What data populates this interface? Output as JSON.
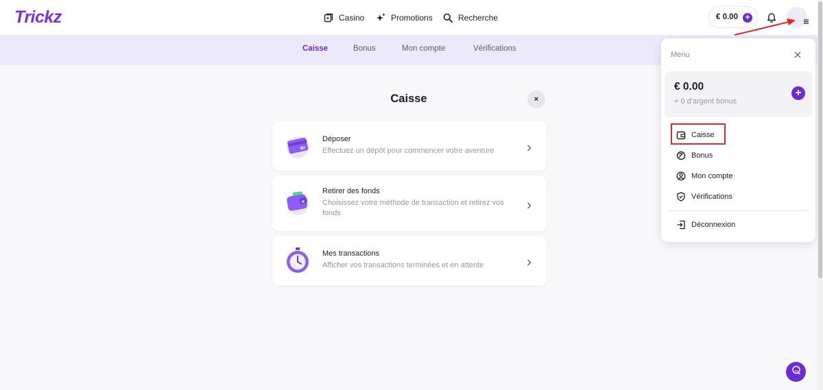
{
  "brand": {
    "logo": "Trickz",
    "accent_color": "#6c2bd9"
  },
  "header": {
    "nav": [
      {
        "label": "Casino",
        "icon": "casino-icon"
      },
      {
        "label": "Promotions",
        "icon": "sparkle-icon"
      },
      {
        "label": "Recherche",
        "icon": "search-icon"
      }
    ],
    "balance": "€ 0.00",
    "add_funds_glyph": "+",
    "notifications_icon": "bell-icon",
    "menu_icon": "hamburger-icon"
  },
  "subnav": {
    "tabs": [
      {
        "label": "Caisse",
        "active": true
      },
      {
        "label": "Bonus",
        "active": false
      },
      {
        "label": "Mon compte",
        "active": false
      },
      {
        "label": "Vérifications",
        "active": false
      }
    ]
  },
  "main": {
    "title": "Caisse",
    "close_glyph": "×",
    "cards": [
      {
        "title": "Déposer",
        "description": "Effectuez un dépôt pour commencer votre aventure",
        "icon": "card-icon"
      },
      {
        "title": "Retirer des fonds",
        "description": "Choisissez votre méthode de transaction et retirez vos fonds",
        "icon": "wallet-icon"
      },
      {
        "title": "Mes transactions",
        "description": "Afficher vos transactions terminées et en attente",
        "icon": "stopwatch-icon"
      }
    ]
  },
  "menu": {
    "label": "Menu",
    "balance": "€ 0.00",
    "bonus_text": "+ 0 d'argent bonus",
    "plus_glyph": "+",
    "items": [
      {
        "label": "Caisse",
        "icon": "wallet-small-icon",
        "highlighted": true
      },
      {
        "label": "Bonus",
        "icon": "bonus-icon"
      },
      {
        "label": "Mon compte",
        "icon": "user-icon"
      },
      {
        "label": "Vérifications",
        "icon": "shield-icon"
      }
    ],
    "logout": {
      "label": "Déconnexion",
      "icon": "logout-icon"
    }
  },
  "annotation": {
    "color": "#e02626"
  },
  "chat": {
    "icon": "chat-icon"
  }
}
